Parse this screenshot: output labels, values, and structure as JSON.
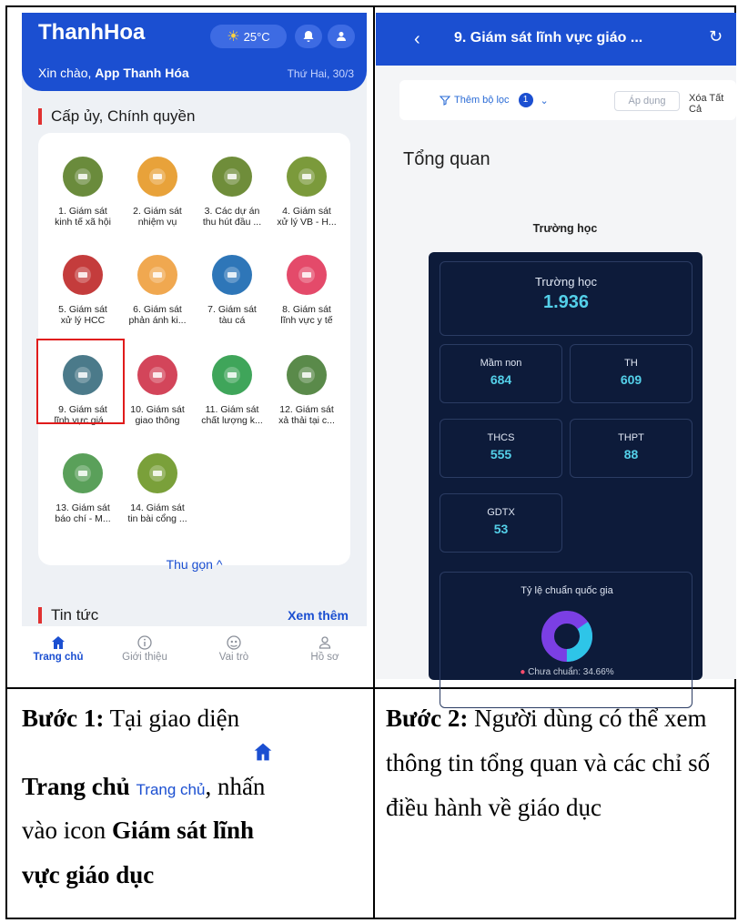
{
  "left_phone": {
    "app_title": "ThanhHoa",
    "weather": "25°C",
    "greeting_prefix": "Xin chào,",
    "greeting_name": "App Thanh Hóa",
    "date": "Thứ Hai, 30/3",
    "section_title": "Cấp ủy, Chính quyền",
    "tiles": [
      {
        "label": "1. Giám sát\nkinh tế xã hội",
        "icon": "growth-chart-icon",
        "color": "#6a8b3c"
      },
      {
        "label": "2. Giám sát\nnhiệm vụ",
        "icon": "coin-gear-icon",
        "color": "#e8a23a"
      },
      {
        "label": "3. Các dự án\nthu hút đầu ...",
        "icon": "hand-money-icon",
        "color": "#6f8d3a"
      },
      {
        "label": "4. Giám sát\nxử lý VB - H...",
        "icon": "documents-icon",
        "color": "#7b9a3b"
      },
      {
        "label": "5. Giám sát\nxử lý HCC",
        "icon": "service-logo-icon",
        "color": "#c43c3c"
      },
      {
        "label": "6. Giám sát\nphản ánh ki...",
        "icon": "envelope-icon",
        "color": "#f0a850"
      },
      {
        "label": "7. Giám sát\ntàu cá",
        "icon": "boat-icon",
        "color": "#2e76b8"
      },
      {
        "label": "8. Giám sát\nlĩnh vực y tế",
        "icon": "heartbeat-icon",
        "color": "#e44a6a"
      },
      {
        "label": "9. Giám sát\nlĩnh vực giá...",
        "icon": "graduation-cap-icon",
        "color": "#4b7a8a"
      },
      {
        "label": "10. Giám sát\ngiao thông",
        "icon": "camera-icon",
        "color": "#d3455a"
      },
      {
        "label": "11. Giám sát\nchất lượng k...",
        "icon": "globe-leaf-icon",
        "color": "#3fa55a"
      },
      {
        "label": "12. Giám sát\nxả thải tại c...",
        "icon": "factory-icon",
        "color": "#5a8a4a"
      },
      {
        "label": "13. Giám sát\nbáo chí - M...",
        "icon": "newspaper-icon",
        "color": "#5aa05a"
      },
      {
        "label": "14. Giám sát\ntin bài cổng ...",
        "icon": "monitor-icon",
        "color": "#7aa03a"
      }
    ],
    "collapse_label": "Thu gọn ^",
    "news_title": "Tin tức",
    "see_more": "Xem thêm",
    "tabs": [
      {
        "label": "Trang chủ",
        "icon": "home-icon"
      },
      {
        "label": "Giới thiệu",
        "icon": "info-icon"
      },
      {
        "label": "Vai trò",
        "icon": "role-icon"
      },
      {
        "label": "Hồ sơ",
        "icon": "profile-icon"
      }
    ]
  },
  "right_phone": {
    "title": "9. Giám sát lĩnh vực giáo ...",
    "filter_add": "Thêm bộ lọc",
    "filter_count": "1",
    "apply": "Áp dụng",
    "clear_all": "Xóa Tất Cả",
    "overview": "Tổng quan",
    "panel_caption": "Trường học",
    "total_label": "Trường học",
    "total_value": "1.936",
    "stats": [
      {
        "label": "Mầm non",
        "value": "684"
      },
      {
        "label": "TH",
        "value": "609"
      },
      {
        "label": "THCS",
        "value": "555"
      },
      {
        "label": "THPT",
        "value": "88"
      },
      {
        "label": "GDTX",
        "value": "53"
      }
    ],
    "donut_title": "Tỷ lệ chuẩn quốc gia",
    "legend": "Chưa chuẩn: 34.66%",
    "donut_share": 0.3466
  },
  "step1": {
    "label": "Bước 1:",
    "text_a": "Tại giao diện",
    "bold_a": "Trang chủ",
    "inline_tab": "Trang chủ",
    "text_b": ", nhấn",
    "text_c": "vào icon",
    "bold_b": "Giám sát lĩnh",
    "bold_c": "vực giáo dục"
  },
  "step2": {
    "label": "Bước 2:",
    "text": "Người dùng có thể xem thông tin tổng quan và các chỉ số điều hành về giáo dục"
  }
}
